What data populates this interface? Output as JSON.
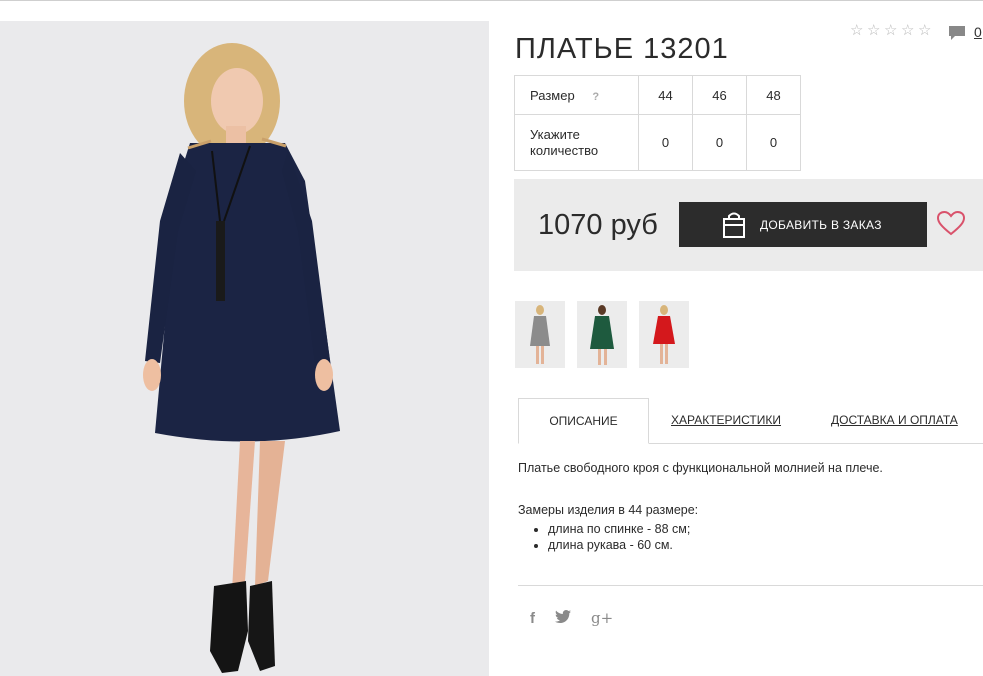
{
  "product": {
    "title": "ПЛАТЬЕ 13201",
    "rating_stars": 5,
    "comments_count": "0"
  },
  "size_table": {
    "size_label": "Размер",
    "help": "?",
    "sizes": [
      "44",
      "46",
      "48"
    ],
    "qty_label": "Укажите количество",
    "quantities": [
      "0",
      "0",
      "0"
    ]
  },
  "purchase": {
    "price": "1070 руб",
    "add_button": "ДОБАВИТЬ В ЗАКАЗ"
  },
  "thumbnails": [
    {
      "color": "#8c8c8c"
    },
    {
      "color": "#1e5a3e"
    },
    {
      "color": "#d4181c"
    }
  ],
  "tabs": [
    {
      "label": "ОПИСАНИЕ",
      "active": true
    },
    {
      "label": "ХАРАКТЕРИСТИКИ",
      "active": false
    },
    {
      "label": "ДОСТАВКА И ОПЛАТА",
      "active": false
    }
  ],
  "description": {
    "text": "Платье свободного кроя с функциональной молнией на плече.",
    "measures_title": "Замеры изделия в 44 размере:",
    "measures": [
      "длина по спинке - 88 см;",
      "длина рукава - 60 см."
    ]
  },
  "social": {
    "icons": [
      "facebook-icon",
      "twitter-icon",
      "google-plus-icon"
    ],
    "facebook": "f",
    "twitter": "t",
    "googleplus": "g+"
  },
  "colors": {
    "dress": "#1b2444",
    "button": "#2c2c2c",
    "heart": "#d9526b",
    "panel": "#ebebeb"
  }
}
